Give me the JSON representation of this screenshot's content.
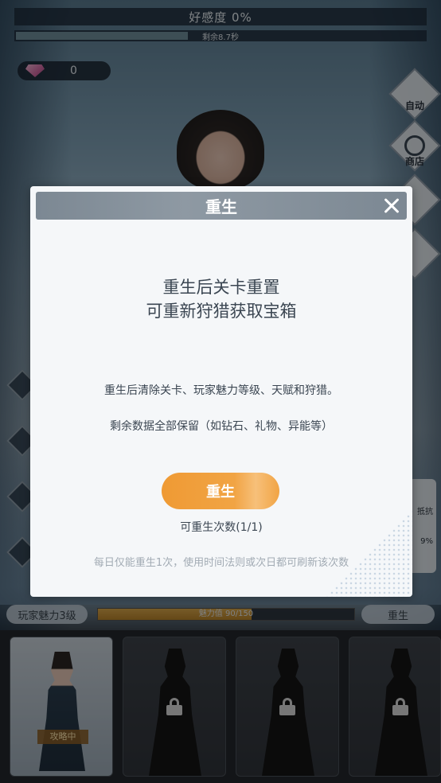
{
  "hud": {
    "affinity_label": "好感度 0%",
    "timer_label": "剩余8.7秒",
    "timer_progress": 0.42,
    "diamond_count": "0"
  },
  "side_buttons": [
    {
      "label": "自动",
      "icon": "auto-icon"
    },
    {
      "label": "商店",
      "icon": "shop-icon"
    }
  ],
  "right_card": {
    "line1": "抵抗",
    "line2": "9%"
  },
  "bottom": {
    "charm_level": "玩家魅力3级",
    "charm_bar_text": "魅力值 90/150",
    "charm_progress": 0.6,
    "rebirth_label": "重生"
  },
  "characters": [
    {
      "state": "active",
      "tag": "攻略中"
    },
    {
      "state": "locked"
    },
    {
      "state": "locked"
    },
    {
      "state": "locked"
    }
  ],
  "modal": {
    "title": "重生",
    "headline_1": "重生后关卡重置",
    "headline_2": "可重新狩猎获取宝箱",
    "body_1": "重生后清除关卡、玩家魅力等级、天赋和狩猎。",
    "body_2": "剩余数据全部保留（如钻石、礼物、异能等）",
    "button_label": "重生",
    "count_text": "可重生次数(1/1)",
    "note": "每日仅能重生1次，使用时间法则或次日都可刷新该次数"
  },
  "colors": {
    "accent_orange": "#ef9a34",
    "modal_header": "#8e99a3",
    "charm_fill": "#c8932f"
  }
}
